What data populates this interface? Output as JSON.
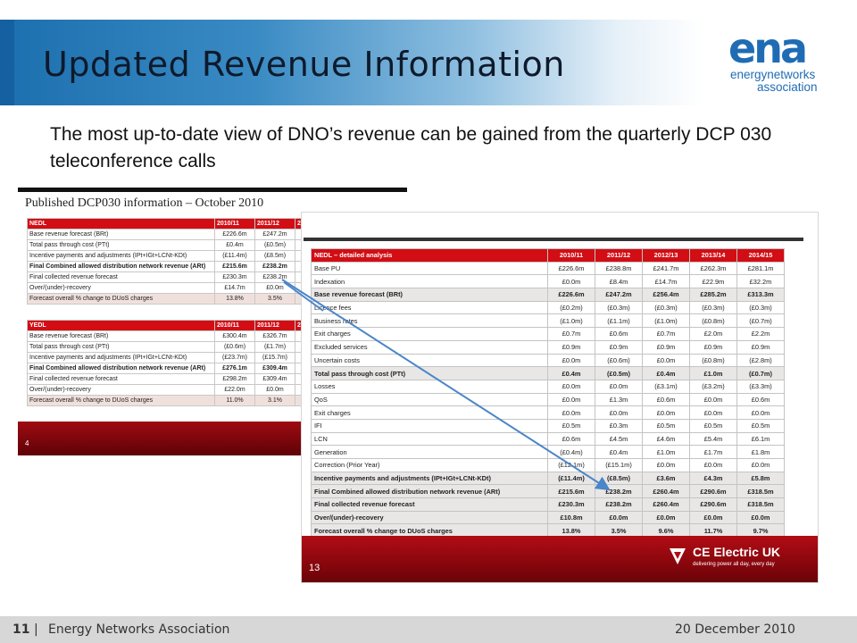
{
  "slide": {
    "title": "Updated Revenue Information",
    "intro": "The most up-to-date view of DNO’s revenue can be gained from the quarterly DCP 030 teleconference calls"
  },
  "logo": {
    "mark": "ena",
    "line1": "energynetworks",
    "line2": "association"
  },
  "back_doc": {
    "title": "Published DCP030 information – October 2010",
    "page_number": "4",
    "nedl": {
      "headers": [
        "NEDL",
        "2010/11",
        "2011/12",
        "20"
      ],
      "rows": [
        {
          "label": "Base revenue forecast (BRt)",
          "v": [
            "£226.6m",
            "£247.2m",
            "£2"
          ]
        },
        {
          "label": "Total pass through cost (PTt)",
          "v": [
            "£0.4m",
            "(£0.5m)",
            "£"
          ]
        },
        {
          "label": "Incentive payments and adjustments (IPt+IGt+LCNt-KDt)",
          "v": [
            "(£11.4m)",
            "(£8.5m)",
            "£"
          ]
        },
        {
          "label": "Final Combined allowed distribution network revenue (ARt)",
          "v": [
            "£215.6m",
            "£238.2m",
            "£2"
          ]
        },
        {
          "label": "Final collected revenue forecast",
          "v": [
            "£230.3m",
            "£238.2m",
            "£2"
          ]
        },
        {
          "label": "Over/(under)-recovery",
          "v": [
            "£14.7m",
            "£0.0m",
            "£"
          ]
        },
        {
          "label": "Forecast overall % change to DUoS charges",
          "v": [
            "13.8%",
            "3.5%",
            "9"
          ]
        }
      ]
    },
    "yedl": {
      "headers": [
        "YEDL",
        "2010/11",
        "2011/12",
        "20"
      ],
      "rows": [
        {
          "label": "Base revenue forecast (BRt)",
          "v": [
            "£300.4m",
            "£326.7m",
            "£3"
          ]
        },
        {
          "label": "Total pass through cost (PTt)",
          "v": [
            "(£0.6m)",
            "(£1.7m)",
            "£"
          ]
        },
        {
          "label": "Incentive payments and adjustments (IPt+IGt+LCNt-KDt)",
          "v": [
            "(£23.7m)",
            "(£15.7m)",
            "£"
          ]
        },
        {
          "label": "Final Combined allowed distribution network revenue (ARt)",
          "v": [
            "£276.1m",
            "£309.4m",
            "£3"
          ]
        },
        {
          "label": "Final collected revenue forecast",
          "v": [
            "£298.2m",
            "£309.4m",
            "£3"
          ]
        },
        {
          "label": "Over/(under)-recovery",
          "v": [
            "£22.0m",
            "£0.0m",
            "£"
          ]
        },
        {
          "label": "Forecast overall % change to DUoS charges",
          "v": [
            "11.0%",
            "3.1%",
            "6"
          ]
        }
      ]
    }
  },
  "front_doc": {
    "page_number": "13",
    "brand_name": "CE Electric UK",
    "brand_tagline": "delivering power all day, every day",
    "headers": [
      "NEDL – detailed analysis",
      "2010/11",
      "2011/12",
      "2012/13",
      "2013/14",
      "2014/15"
    ],
    "rows": [
      {
        "label": "Base PU",
        "v": [
          "£226.6m",
          "£238.8m",
          "£241.7m",
          "£262.3m",
          "£281.1m"
        ]
      },
      {
        "label": "Indexation",
        "v": [
          "£0.0m",
          "£8.4m",
          "£14.7m",
          "£22.9m",
          "£32.2m"
        ]
      },
      {
        "label": "Base revenue forecast (BRt)",
        "v": [
          "£226.6m",
          "£247.2m",
          "£256.4m",
          "£285.2m",
          "£313.3m"
        ],
        "bold": true
      },
      {
        "label": "Licence fees",
        "v": [
          "(£0.2m)",
          "(£0.3m)",
          "(£0.3m)",
          "(£0.3m)",
          "(£0.3m)"
        ]
      },
      {
        "label": "Business rates",
        "v": [
          "(£1.0m)",
          "(£1.1m)",
          "(£1.0m)",
          "(£0.8m)",
          "(£0.7m)"
        ]
      },
      {
        "label": "Exit charges",
        "v": [
          "£0.7m",
          "£0.6m",
          "£0.7m",
          "£2.0m",
          "£2.2m"
        ]
      },
      {
        "label": "Excluded services",
        "v": [
          "£0.9m",
          "£0.9m",
          "£0.9m",
          "£0.9m",
          "£0.9m"
        ]
      },
      {
        "label": "Uncertain costs",
        "v": [
          "£0.0m",
          "(£0.6m)",
          "£0.0m",
          "(£0.8m)",
          "(£2.8m)"
        ]
      },
      {
        "label": "Total pass through cost (PTt)",
        "v": [
          "£0.4m",
          "(£0.5m)",
          "£0.4m",
          "£1.0m",
          "(£0.7m)"
        ],
        "bold": true
      },
      {
        "label": "Losses",
        "v": [
          "£0.0m",
          "£0.0m",
          "(£3.1m)",
          "(£3.2m)",
          "(£3.3m)"
        ]
      },
      {
        "label": "QoS",
        "v": [
          "£0.0m",
          "£1.3m",
          "£0.6m",
          "£0.0m",
          "£0.6m"
        ]
      },
      {
        "label": "Exit charges",
        "v": [
          "£0.0m",
          "£0.0m",
          "£0.0m",
          "£0.0m",
          "£0.0m"
        ]
      },
      {
        "label": "IFI",
        "v": [
          "£0.5m",
          "£0.3m",
          "£0.5m",
          "£0.5m",
          "£0.5m"
        ]
      },
      {
        "label": "LCN",
        "v": [
          "£0.6m",
          "£4.5m",
          "£4.6m",
          "£5.4m",
          "£6.1m"
        ]
      },
      {
        "label": "Generation",
        "v": [
          "(£0.4m)",
          "£0.4m",
          "£1.0m",
          "£1.7m",
          "£1.8m"
        ]
      },
      {
        "label": "Correction (Prior Year)",
        "v": [
          "(£12.1m)",
          "(£15.1m)",
          "£0.0m",
          "£0.0m",
          "£0.0m"
        ]
      },
      {
        "label": "Incentive payments and adjustments (IPt+IGt+LCNt-KDt)",
        "v": [
          "(£11.4m)",
          "(£8.5m)",
          "£3.6m",
          "£4.3m",
          "£5.8m"
        ],
        "bold": true
      },
      {
        "label": "Final Combined allowed distribution network revenue (ARt)",
        "v": [
          "£215.6m",
          "£238.2m",
          "£260.4m",
          "£290.6m",
          "£318.5m"
        ],
        "bold": true
      },
      {
        "label": "Final collected revenue forecast",
        "v": [
          "£230.3m",
          "£238.2m",
          "£260.4m",
          "£290.6m",
          "£318.5m"
        ],
        "bold": true
      },
      {
        "label": "Over/(under)-recovery",
        "v": [
          "£10.8m",
          "£0.0m",
          "£0.0m",
          "£0.0m",
          "£0.0m"
        ],
        "bold": true
      },
      {
        "label": "Forecast overall % change to DUoS charges",
        "v": [
          "13.8%",
          "3.5%",
          "9.6%",
          "11.7%",
          "9.7%"
        ],
        "bold": true
      }
    ]
  },
  "footer": {
    "page": "11",
    "separator": "|",
    "org": "Energy Networks Association",
    "date": "20 December 2010"
  },
  "colors": {
    "header_blue": "#1c6fae",
    "table_red": "#d20d14",
    "arrow_blue": "#4a86c8",
    "logo_blue": "#1f6cb5",
    "logo_green": "#59a12f"
  }
}
